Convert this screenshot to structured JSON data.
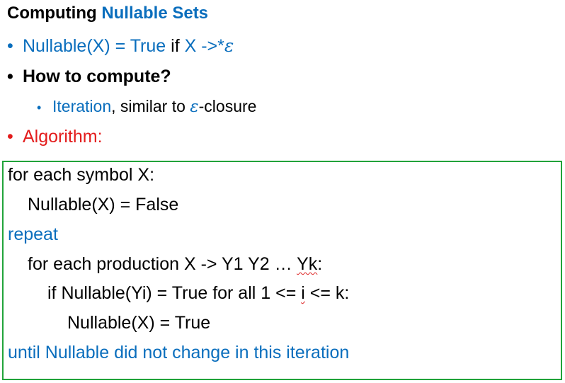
{
  "title": {
    "prefix": "Computing",
    "highlight": "Nullable Sets"
  },
  "bullets": {
    "def": {
      "part1": "Nullable(X) = True",
      "part2": "if",
      "part3": "X ->*",
      "eps": "ε"
    },
    "how": "How to compute?",
    "sub": {
      "part1": "Iteration",
      "part2": ", similar to ",
      "eps": "ε",
      "part3": "-closure"
    },
    "algo": "Algorithm:"
  },
  "code": {
    "l1": "for each symbol X:",
    "l2": "Nullable(X) = False",
    "l3": "repeat",
    "l4a": "for each production X -> Y1 Y2 … ",
    "l4b": "Yk",
    "l4c": ":",
    "l5a": "if Nullable(Yi) = True for all 1 <= ",
    "l5b": "i",
    "l5c": " <= k:",
    "l6": "Nullable(X) = True",
    "l7": "until Nullable did not change in this iteration"
  },
  "colors": {
    "blue": "#0a6ebd",
    "red": "#e31c1c",
    "green_border": "#21a33a"
  }
}
